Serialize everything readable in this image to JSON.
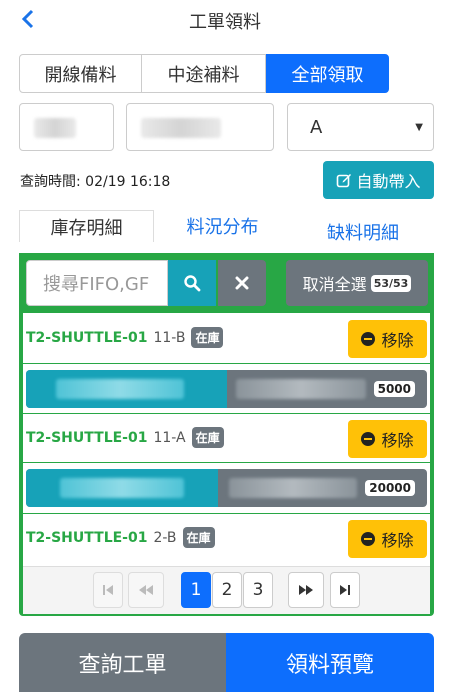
{
  "header": {
    "title": "工單領料"
  },
  "segment_tabs": [
    {
      "label": "開線備料",
      "active": false
    },
    {
      "label": "中途補料",
      "active": false
    },
    {
      "label": "全部領取",
      "active": true
    }
  ],
  "filters": {
    "select_value": "A"
  },
  "query_time": "查詢時間: 02/19 16:18",
  "auto_fill_label": "自動帶入",
  "view_tabs": [
    {
      "label": "庫存明細",
      "active": true
    },
    {
      "label": "料況分布",
      "active": false
    },
    {
      "label": "缺料明細",
      "active": false
    }
  ],
  "search": {
    "placeholder": "搜尋FIFO,GF"
  },
  "deselect": {
    "label": "取消全選",
    "count": "53/53"
  },
  "items": [
    {
      "tag": "T2-SHUTTLE-01",
      "location": "11-B",
      "status": "在庫",
      "remove_label": "移除",
      "quantity": "5000",
      "fill_fraction": 0.5
    },
    {
      "tag": "T2-SHUTTLE-01",
      "location": "11-A",
      "status": "在庫",
      "remove_label": "移除",
      "quantity": "20000",
      "fill_fraction": 0.48
    },
    {
      "tag": "T2-SHUTTLE-01",
      "location": "2-B",
      "status": "在庫",
      "remove_label": "移除"
    }
  ],
  "pagination": {
    "pages": [
      "1",
      "2",
      "3"
    ],
    "current": "1"
  },
  "bottom": {
    "query_label": "查詢工單",
    "preview_label": "領料預覽"
  },
  "colors": {
    "primary": "#0d6efd",
    "info": "#17a2b8",
    "success": "#28a745",
    "warning": "#ffc107",
    "secondary": "#6c757d"
  }
}
